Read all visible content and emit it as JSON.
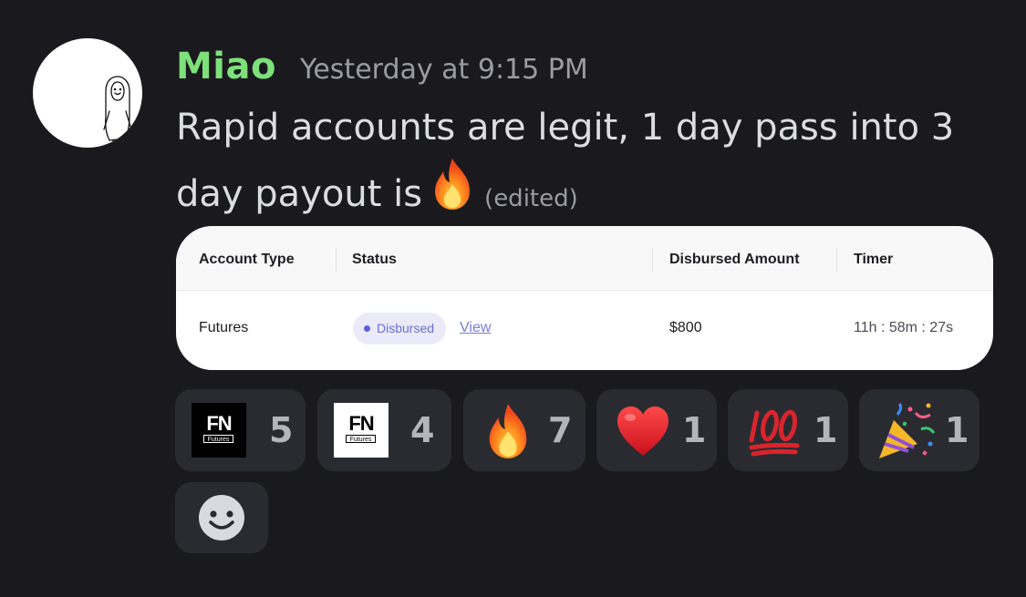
{
  "message": {
    "author": "Miao",
    "timestamp": "Yesterday at 9:15 PM",
    "text_line1": "Rapid accounts are legit, 1 day pass into 3",
    "text_line2": "day payout is",
    "inline_emoji": "fire-icon",
    "edited_label": "(edited)"
  },
  "card": {
    "headers": {
      "account_type": "Account Type",
      "status": "Status",
      "disbursed_amount": "Disbursed Amount",
      "timer": "Timer"
    },
    "row": {
      "account_type": "Futures",
      "status": "Disbursed",
      "view_link": "View",
      "disbursed_amount": "$800",
      "timer": "11h : 58m : 27s"
    }
  },
  "reactions": [
    {
      "icon": "fn-futures-logo-dark",
      "logo_text": "FN",
      "logo_sub": "Futures",
      "count": "5"
    },
    {
      "icon": "fn-futures-logo-light",
      "logo_text": "FN",
      "logo_sub": "Futures",
      "count": "4"
    },
    {
      "icon": "fire-icon",
      "count": "7"
    },
    {
      "icon": "red-heart-icon",
      "count": "1"
    },
    {
      "icon": "hundred-points-icon",
      "count": "1"
    },
    {
      "icon": "party-popper-icon",
      "count": "1"
    }
  ],
  "add_reaction": {
    "icon": "smiley-add-reaction-icon"
  },
  "colors": {
    "background": "#1a1a1e",
    "username": "#7ee07a",
    "timestamp": "#9a9ba3",
    "message_text": "#dcdde1",
    "reaction_bg": "#2a2b31",
    "badge_bg": "#eaeaf8",
    "badge_text": "#6a6fce",
    "link": "#7a79d9"
  }
}
